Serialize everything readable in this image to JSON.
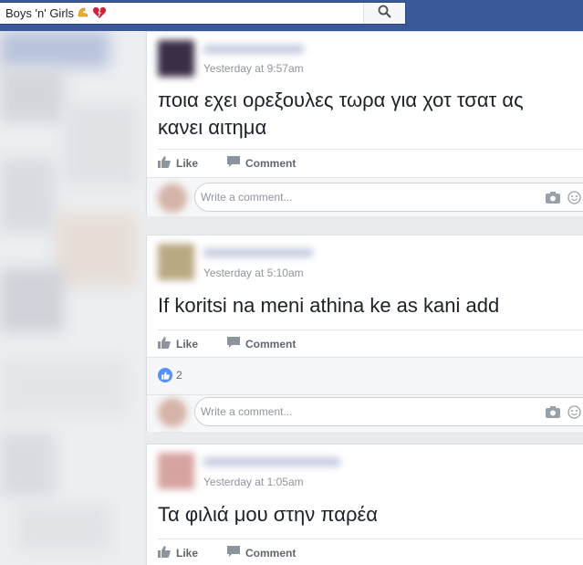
{
  "search": {
    "value": "Boys 'n' Girls",
    "emoji": [
      "flexed-biceps-icon",
      "heart-icon"
    ]
  },
  "colors": {
    "topbar": "#3b5998",
    "like_blue": "#5890ff",
    "meta_gray": "#90949c",
    "action_gray": "#616770"
  },
  "posts": [
    {
      "timestamp": "Yesterday at 9:57am",
      "text_line1": "ποια εχει ορεξουλες τωρα για χοτ τσατ ας",
      "text_line2": "κανει αιτημα",
      "like_label": "Like",
      "comment_label": "Comment",
      "comment_placeholder": "Write a comment..."
    },
    {
      "timestamp": "Yesterday at 5:10am",
      "text_line1": "If koritsi na meni athina ke as kani add",
      "like_label": "Like",
      "comment_label": "Comment",
      "reaction_count": "2",
      "comment_placeholder": "Write a comment..."
    },
    {
      "timestamp": "Yesterday at 1:05am",
      "text_line1": "Τα φιλιά μου στην παρέα",
      "like_label": "Like",
      "comment_label": "Comment"
    }
  ]
}
